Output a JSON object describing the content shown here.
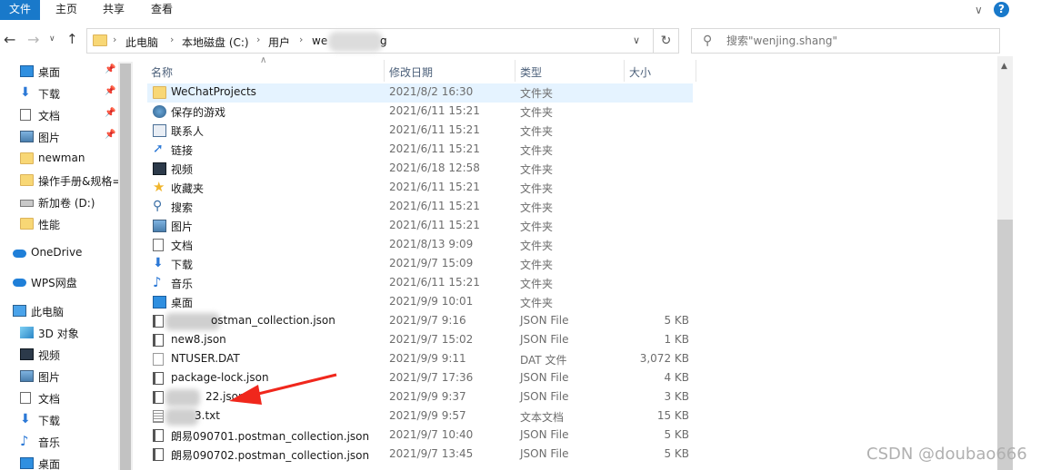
{
  "ribbon": {
    "tabs": [
      {
        "label": "文件",
        "active": true
      },
      {
        "label": "主页",
        "active": false
      },
      {
        "label": "共享",
        "active": false
      },
      {
        "label": "查看",
        "active": false
      }
    ],
    "help_label": "?"
  },
  "addressbar": {
    "crumbs": [
      "此电脑",
      "本地磁盘 (C:)",
      "用户",
      "we",
      "g"
    ],
    "separator": "›"
  },
  "search": {
    "placeholder": "搜索\"wenjing.shang\""
  },
  "nav": {
    "items": [
      {
        "label": "桌面",
        "icon": "desktop-icon",
        "pinned": true
      },
      {
        "label": "下载",
        "icon": "download-icon",
        "pinned": true
      },
      {
        "label": "文档",
        "icon": "document-icon",
        "pinned": true
      },
      {
        "label": "图片",
        "icon": "picture-icon",
        "pinned": true
      },
      {
        "label": "newman",
        "icon": "folder-icon",
        "pinned": false
      },
      {
        "label": "操作手册&规格=",
        "icon": "folder-icon",
        "pinned": false
      },
      {
        "label": "新加卷 (D:)",
        "icon": "drive-icon",
        "pinned": false
      },
      {
        "label": "性能",
        "icon": "folder-icon",
        "pinned": false
      },
      {
        "label": "OneDrive",
        "icon": "cloud-icon",
        "pinned": false
      },
      {
        "label": "WPS网盘",
        "icon": "cloud-icon",
        "pinned": false
      },
      {
        "label": "此电脑",
        "icon": "computer-icon",
        "pinned": false
      },
      {
        "label": "3D 对象",
        "icon": "3d-objects-icon",
        "pinned": false
      },
      {
        "label": "视频",
        "icon": "video-icon",
        "pinned": false
      },
      {
        "label": "图片",
        "icon": "picture-icon",
        "pinned": false
      },
      {
        "label": "文档",
        "icon": "document-icon",
        "pinned": false
      },
      {
        "label": "下载",
        "icon": "download-icon",
        "pinned": false
      },
      {
        "label": "音乐",
        "icon": "music-icon",
        "pinned": false
      },
      {
        "label": "桌面",
        "icon": "desktop-icon",
        "pinned": false
      }
    ]
  },
  "columns": {
    "name": "名称",
    "date": "修改日期",
    "type": "类型",
    "size": "大小"
  },
  "files": [
    {
      "name": "WeChatProjects",
      "date": "2021/8/2 16:30",
      "type": "文件夹",
      "size": "",
      "icon": "folder-icon",
      "selected": true
    },
    {
      "name": "保存的游戏",
      "date": "2021/6/11 15:21",
      "type": "文件夹",
      "size": "",
      "icon": "saved-games-icon"
    },
    {
      "name": "联系人",
      "date": "2021/6/11 15:21",
      "type": "文件夹",
      "size": "",
      "icon": "contacts-icon"
    },
    {
      "name": "链接",
      "date": "2021/6/11 15:21",
      "type": "文件夹",
      "size": "",
      "icon": "link-icon"
    },
    {
      "name": "视频",
      "date": "2021/6/18 12:58",
      "type": "文件夹",
      "size": "",
      "icon": "video-icon"
    },
    {
      "name": "收藏夹",
      "date": "2021/6/11 15:21",
      "type": "文件夹",
      "size": "",
      "icon": "star-icon"
    },
    {
      "name": "搜索",
      "date": "2021/6/11 15:21",
      "type": "文件夹",
      "size": "",
      "icon": "search-folder-icon"
    },
    {
      "name": "图片",
      "date": "2021/6/11 15:21",
      "type": "文件夹",
      "size": "",
      "icon": "picture-icon"
    },
    {
      "name": "文档",
      "date": "2021/8/13 9:09",
      "type": "文件夹",
      "size": "",
      "icon": "document-icon"
    },
    {
      "name": "下载",
      "date": "2021/9/7 15:09",
      "type": "文件夹",
      "size": "",
      "icon": "download-icon"
    },
    {
      "name": "音乐",
      "date": "2021/6/11 15:21",
      "type": "文件夹",
      "size": "",
      "icon": "music-icon"
    },
    {
      "name": "桌面",
      "date": "2021/9/9 10:01",
      "type": "文件夹",
      "size": "",
      "icon": "desktop-icon"
    },
    {
      "name": "ostman_collection.json",
      "date": "2021/9/7 9:16",
      "type": "JSON File",
      "size": "5 KB",
      "icon": "json-file-icon"
    },
    {
      "name": "new8.json",
      "date": "2021/9/7 15:02",
      "type": "JSON File",
      "size": "1 KB",
      "icon": "json-file-icon"
    },
    {
      "name": "NTUSER.DAT",
      "date": "2021/9/9 9:11",
      "type": "DAT 文件",
      "size": "3,072 KB",
      "icon": "blank-file-icon"
    },
    {
      "name": "package-lock.json",
      "date": "2021/9/7 17:36",
      "type": "JSON File",
      "size": "4 KB",
      "icon": "json-file-icon"
    },
    {
      "name": "22.json",
      "date": "2021/9/9 9:37",
      "type": "JSON File",
      "size": "3 KB",
      "icon": "json-file-icon"
    },
    {
      "name": "3.txt",
      "date": "2021/9/9 9:57",
      "type": "文本文档",
      "size": "15 KB",
      "icon": "text-file-icon"
    },
    {
      "name": "朗易090701.postman_collection.json",
      "date": "2021/9/7 10:40",
      "type": "JSON File",
      "size": "5 KB",
      "icon": "json-file-icon"
    },
    {
      "name": "朗易090702.postman_collection.json",
      "date": "2021/9/7 13:45",
      "type": "JSON File",
      "size": "5 KB",
      "icon": "json-file-icon"
    }
  ],
  "watermark": "CSDN @doubao666",
  "colors": {
    "accent": "#1979ca",
    "selected_row": "#e5f3ff",
    "annotation_arrow": "#f0271c"
  }
}
